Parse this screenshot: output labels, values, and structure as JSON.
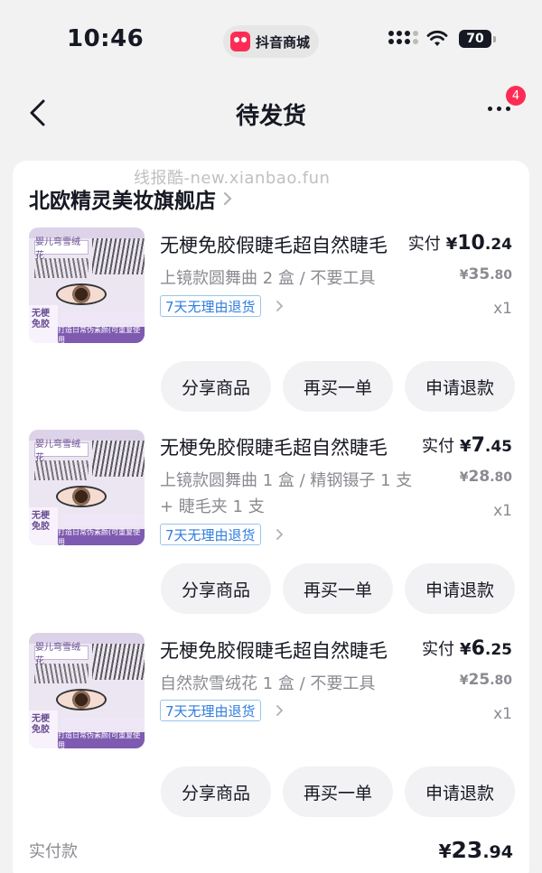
{
  "status_bar": {
    "time": "10:46",
    "app_pill": "抖音商城",
    "battery": "70"
  },
  "nav": {
    "title": "待发货",
    "badge_count": "4"
  },
  "watermark": "线报酷-new.xianbao.fun",
  "shop": {
    "name": "北欧精灵美妆旗舰店"
  },
  "thumbnail": {
    "brand": "NODIC ELVES | 北欧精灵",
    "product_line": "婴儿弯雪绒花",
    "side_tag": "无梗免胶",
    "bottom_text": "打造日常伪素颜(可重复使用"
  },
  "items": [
    {
      "title": "无梗免胶假睫毛超自然睫毛",
      "spec": "上镜款圆舞曲 2 盒 / 不要工具",
      "tag": "7天无理由退货",
      "paid_label": "实付",
      "paid_currency": "¥",
      "paid_int": "10",
      "paid_dec": ".24",
      "orig_currency": "¥",
      "orig_int": "35",
      "orig_dec": ".80",
      "qty": "x1"
    },
    {
      "title": "无梗免胶假睫毛超自然睫毛",
      "spec": "上镜款圆舞曲 1 盒 / 精钢镊子 1 支 + 睫毛夹 1 支",
      "tag": "7天无理由退货",
      "paid_label": "实付",
      "paid_currency": "¥",
      "paid_int": "7",
      "paid_dec": ".45",
      "orig_currency": "¥",
      "orig_int": "28",
      "orig_dec": ".80",
      "qty": "x1"
    },
    {
      "title": "无梗免胶假睫毛超自然睫毛",
      "spec": "自然款雪绒花 1 盒 / 不要工具",
      "tag": "7天无理由退货",
      "paid_label": "实付",
      "paid_currency": "¥",
      "paid_int": "6",
      "paid_dec": ".25",
      "orig_currency": "¥",
      "orig_int": "25",
      "orig_dec": ".80",
      "qty": "x1"
    }
  ],
  "buttons": {
    "share": "分享商品",
    "rebuy": "再买一单",
    "refund": "申请退款"
  },
  "total": {
    "label": "实付款",
    "currency": "¥",
    "int": "23",
    "dec": ".94"
  }
}
